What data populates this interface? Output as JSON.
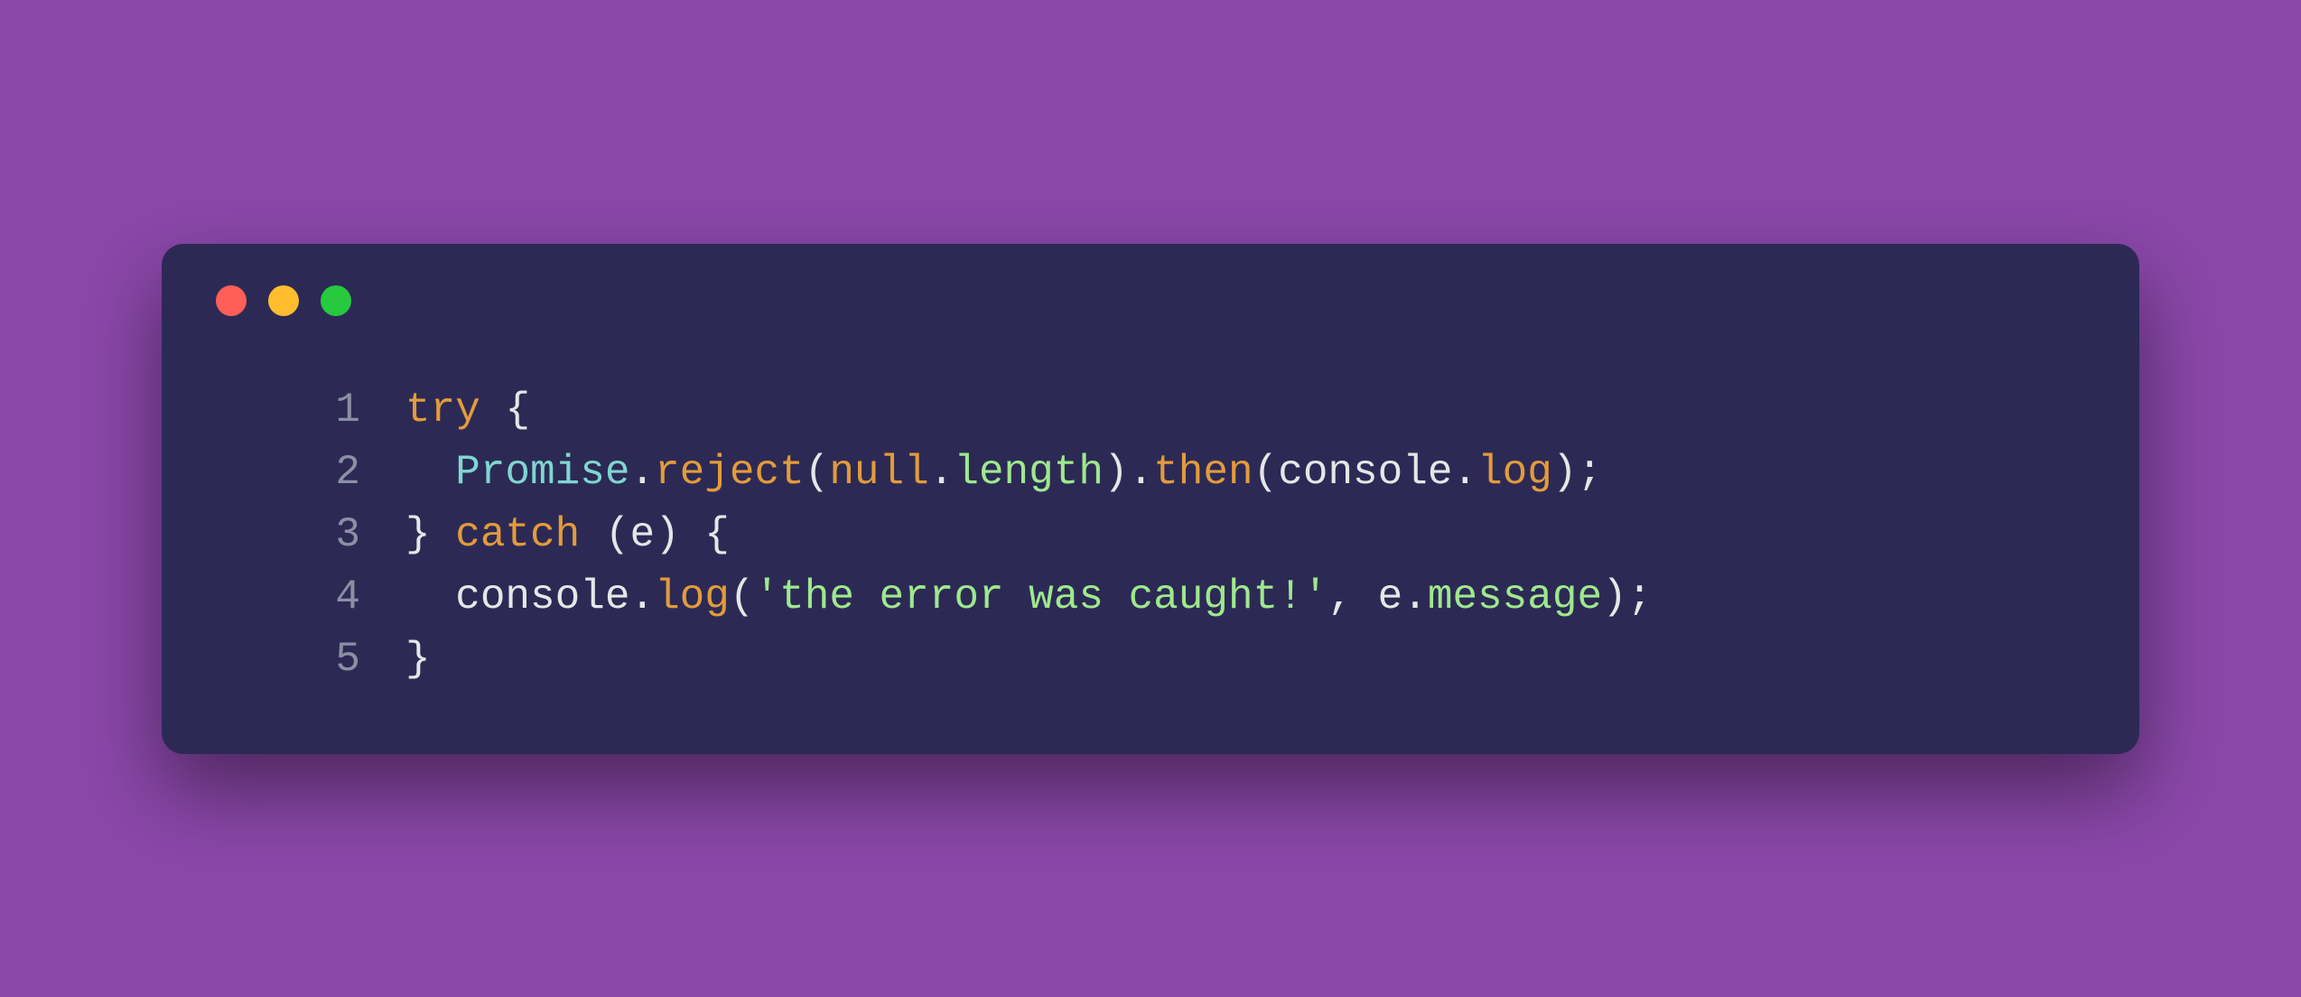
{
  "window": {
    "traffic_lights": [
      "close",
      "minimize",
      "zoom"
    ]
  },
  "code": {
    "line_numbers": [
      "1",
      "2",
      "3",
      "4",
      "5"
    ],
    "lines": {
      "l1": {
        "try": "try",
        "sp": " ",
        "brace": "{"
      },
      "l2": {
        "indent": "  ",
        "Promise": "Promise",
        "dot1": ".",
        "reject": "reject",
        "open1": "(",
        "null": "null",
        "dot2": ".",
        "length": "length",
        "close1": ")",
        "dot3": ".",
        "then": "then",
        "open2": "(",
        "console": "console",
        "dot4": ".",
        "log": "log",
        "close2": ")",
        "semi": ";"
      },
      "l3": {
        "closebrace": "}",
        "sp1": " ",
        "catch": "catch",
        "sp2": " ",
        "open": "(",
        "e": "e",
        "close": ")",
        "sp3": " ",
        "brace": "{"
      },
      "l4": {
        "indent": "  ",
        "console": "console",
        "dot": ".",
        "log": "log",
        "open": "(",
        "str": "'the error was caught!'",
        "comma": ",",
        "sp": " ",
        "e": "e",
        "dot2": ".",
        "message": "message",
        "close": ")",
        "semi": ";"
      },
      "l5": {
        "brace": "}"
      }
    }
  }
}
